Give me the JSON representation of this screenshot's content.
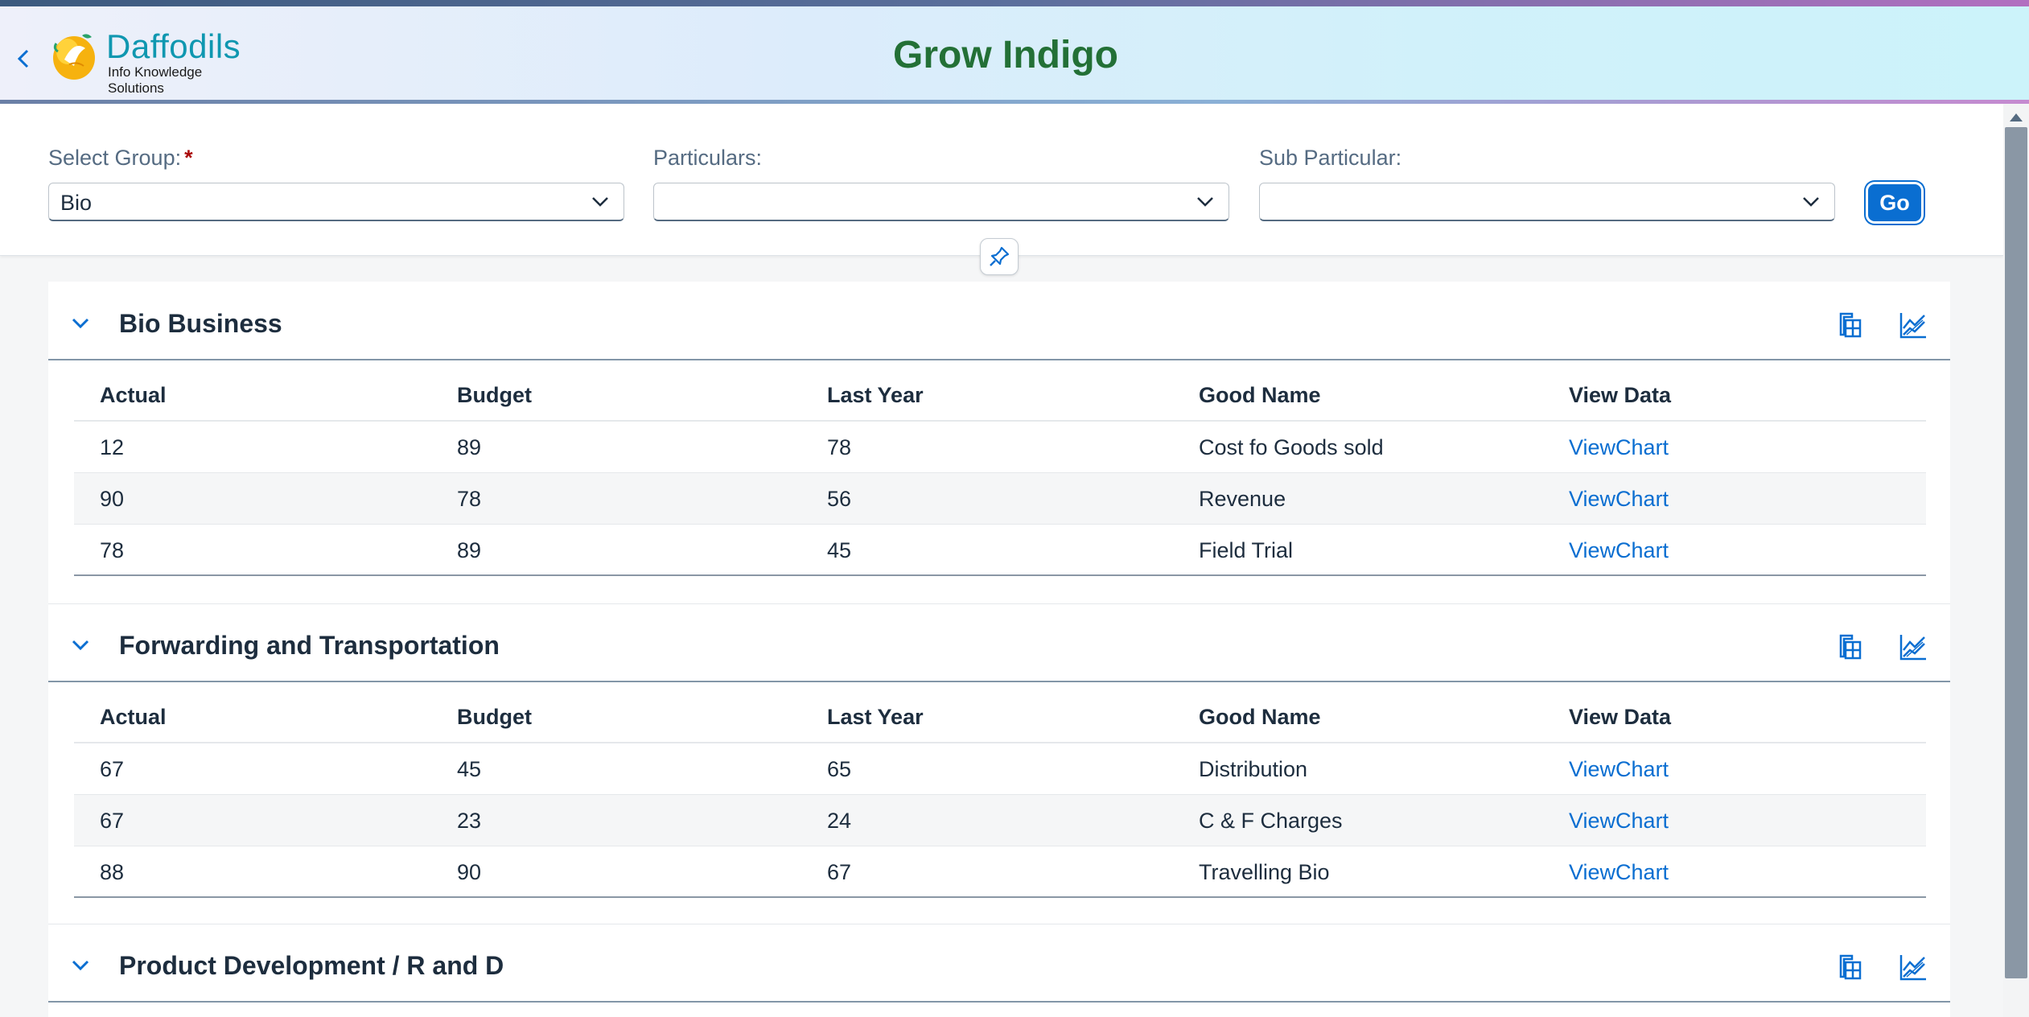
{
  "header": {
    "logo_name": "Daffodils",
    "logo_tagline": "Info Knowledge Solutions",
    "title": "Grow Indigo"
  },
  "filters": {
    "group_label": "Select Group:",
    "group_required_mark": "*",
    "group_value": "Bio",
    "particulars_label": "Particulars:",
    "particulars_value": "",
    "sub_particular_label": "Sub Particular:",
    "sub_particular_value": "",
    "go_label": "Go"
  },
  "columns": [
    "Actual",
    "Budget",
    "Last Year",
    "Good Name",
    "View Data"
  ],
  "sections": [
    {
      "title": "Bio Business",
      "rows": [
        {
          "actual": "12",
          "budget": "89",
          "last_year": "78",
          "good_name": "Cost fo Goods sold",
          "view": "ViewChart"
        },
        {
          "actual": "90",
          "budget": "78",
          "last_year": "56",
          "good_name": "Revenue",
          "view": "ViewChart"
        },
        {
          "actual": "78",
          "budget": "89",
          "last_year": "45",
          "good_name": "Field Trial",
          "view": "ViewChart"
        }
      ]
    },
    {
      "title": "Forwarding and Transportation",
      "rows": [
        {
          "actual": "67",
          "budget": "45",
          "last_year": "65",
          "good_name": "Distribution",
          "view": "ViewChart"
        },
        {
          "actual": "67",
          "budget": "23",
          "last_year": "24",
          "good_name": "C & F Charges",
          "view": "ViewChart"
        },
        {
          "actual": "88",
          "budget": "90",
          "last_year": "67",
          "good_name": "Travelling Bio",
          "view": "ViewChart"
        }
      ]
    },
    {
      "title": "Product Development / R and D",
      "rows": []
    }
  ],
  "colors": {
    "accent": "#0a6ed1",
    "title_green": "#237036",
    "logo_teal": "#0f97b0",
    "required_red": "#aa0808"
  }
}
